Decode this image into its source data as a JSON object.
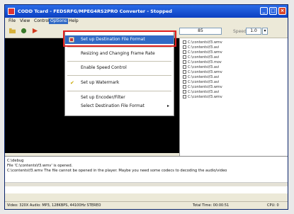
{
  "window": {
    "title": "CODD Tcard - FEDSRFG/MPEG4RS2PRO Converter - Stopped"
  },
  "menubar": {
    "items": [
      "File",
      "View",
      "Control",
      "Options",
      "Help"
    ]
  },
  "toolbar": {
    "value_box": "85",
    "speed_label": "Speed",
    "speed_value": "1.0"
  },
  "options_menu": {
    "items": [
      {
        "label": "Set up Destination File Format"
      },
      {
        "label": "Resizing and Changing Frame Rate"
      },
      {
        "label": "Enable Speed Control"
      },
      {
        "label": "Set up Watermark"
      },
      {
        "label": "Set up Encoder/Filter"
      },
      {
        "label": "Select Destination File Format"
      }
    ]
  },
  "file_list": {
    "items": [
      "C:\\contents\\f3.wmv",
      "C:\\contents\\f3.avi",
      "C:\\contents\\f3.wmv",
      "C:\\contents\\f3.avi",
      "C:\\contents\\f3.mov",
      "C:\\contents\\f3.avi",
      "C:\\contents\\f3.wmv",
      "C:\\contents\\f3.avi",
      "C:\\contents\\f3.avi",
      "C:\\contents\\f3.wmv",
      "C:\\contents\\f3.avi",
      "C:\\contents\\f3.wmv"
    ]
  },
  "log": {
    "lines": [
      "C:\\debug",
      "File 'C:\\contents\\f3.wmv' is opened.",
      "C:\\contents\\f3.wmv The file cannot be opened in the player. Maybe you need some codecs to decoding the audio/video"
    ]
  },
  "status": {
    "left": "Video: 320X Audio: MP3, 128KBPS, 44100Hz STEREO",
    "mid": "Total Time: 00:00:51",
    "right": "CPU: 0"
  },
  "colors": {
    "highlight": "#316ac5",
    "title_bar": "#0b3fc1",
    "callout": "#e02020"
  }
}
